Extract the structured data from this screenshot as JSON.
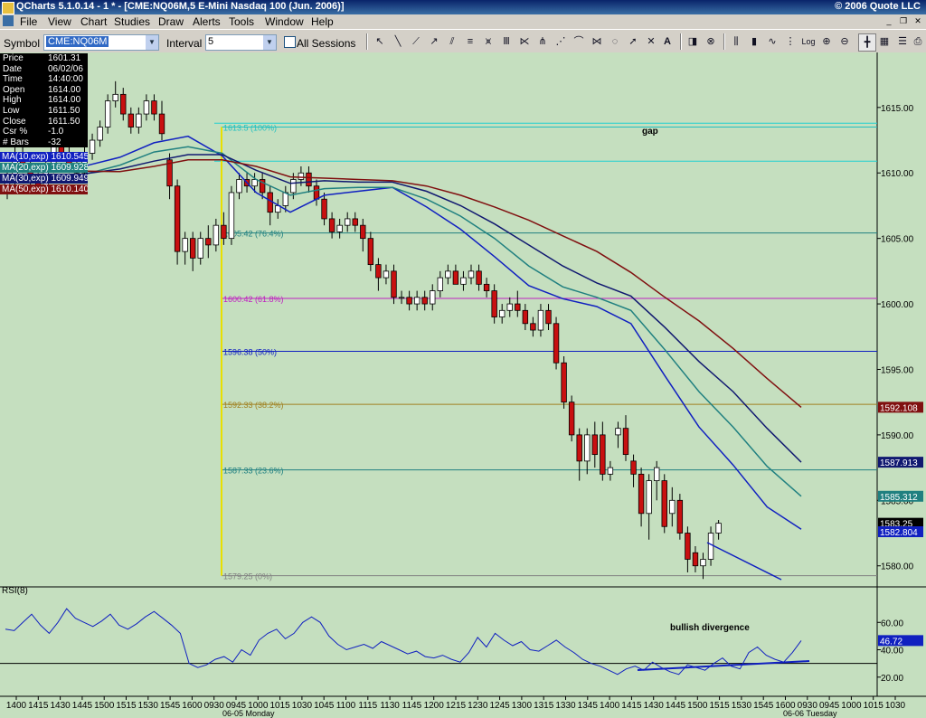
{
  "window": {
    "title": "QCharts 5.1.0.14 - 1 * - [CME:NQ06M,5 E-Mini Nasdaq 100 (Jun. 2006)]",
    "copyright": "© 2006 Quote LLC"
  },
  "menu": [
    "File",
    "View",
    "Chart",
    "Studies",
    "Draw",
    "Alerts",
    "Tools",
    "Window",
    "Help"
  ],
  "toolbar": {
    "symbol_label": "Symbol",
    "symbol_value": "CME:NQ06M",
    "interval_label": "Interval",
    "interval_value": "5",
    "all_sessions_label": "All Sessions",
    "all_sessions_checked": false
  },
  "info": [
    {
      "k": "Price",
      "v": "1601.31"
    },
    {
      "k": "Date",
      "v": "06/02/06"
    },
    {
      "k": "Time",
      "v": "14:40:00"
    },
    {
      "k": "Open",
      "v": "1614.00"
    },
    {
      "k": "High",
      "v": "1614.00"
    },
    {
      "k": "Low",
      "v": "1611.50"
    },
    {
      "k": "Close",
      "v": "1611.50"
    },
    {
      "k": "Csr %",
      "v": "-1.0"
    },
    {
      "k": "# Bars",
      "v": "-32"
    }
  ],
  "moving_averages": [
    {
      "label": "MA(10,exp) 1610.545",
      "color": "#1020c0"
    },
    {
      "label": "MA(20,exp) 1609.928",
      "color": "#208080"
    },
    {
      "label": "MA(30,exp) 1609.949",
      "color": "#101870"
    },
    {
      "label": "MA(50,exp) 1610.140",
      "color": "#801010"
    }
  ],
  "annotations": {
    "gap": "gap",
    "divergence": "bullish divergence",
    "rsi_label": "RSI(8)"
  },
  "fib_levels": [
    {
      "label": "1613.5 (100%)",
      "price": 1613.5,
      "color": "#20c0c0"
    },
    {
      "label": "1605.42 (76.4%)",
      "price": 1605.42,
      "color": "#208080"
    },
    {
      "label": "1600.42 (61.8%)",
      "price": 1600.42,
      "color": "#c020c0"
    },
    {
      "label": "1596.38 (50%)",
      "price": 1596.38,
      "color": "#1020c0"
    },
    {
      "label": "1592.33 (38.2%)",
      "price": 1592.33,
      "color": "#a08020"
    },
    {
      "label": "1587.33 (23.6%)",
      "price": 1587.33,
      "color": "#208080"
    },
    {
      "label": "1579.25 (0%)",
      "price": 1579.25,
      "color": "#808080"
    }
  ],
  "gap_lines": [
    1613.8,
    1610.9
  ],
  "price_axis": {
    "ticks": [
      1615,
      1610,
      1605,
      1600,
      1595,
      1590,
      1585,
      1580
    ],
    "labels": [
      "1615.00",
      "1610.00",
      "1605.00",
      "1600.00",
      "1595.00",
      "1590.00",
      "1585.00",
      "1580.00"
    ]
  },
  "price_tags": [
    {
      "text": "1592.108",
      "price": 1592.108,
      "bg": "#801010",
      "fg": "#fff"
    },
    {
      "text": "1587.913",
      "price": 1587.913,
      "bg": "#101870",
      "fg": "#fff"
    },
    {
      "text": "1585.312",
      "price": 1585.312,
      "bg": "#208080",
      "fg": "#fff"
    },
    {
      "text": "1583.25",
      "price": 1583.25,
      "bg": "#000",
      "fg": "#fff"
    },
    {
      "text": "1582.804",
      "price": 1582.604,
      "bg": "#1020c0",
      "fg": "#fff"
    }
  ],
  "rsi_axis": {
    "ticks": [
      60,
      40,
      20
    ],
    "labels": [
      "60.00",
      "40.00",
      "20.00"
    ],
    "tag": "46.72",
    "tag_value": 46.72
  },
  "time_axis": {
    "labels": [
      "1400",
      "1415",
      "1430",
      "1445",
      "1500",
      "1515",
      "1530",
      "1545",
      "1600",
      "0930",
      "0945",
      "1000",
      "1015",
      "1030",
      "1045",
      "1100",
      "1115",
      "1130",
      "1145",
      "1200",
      "1215",
      "1230",
      "1245",
      "1300",
      "1315",
      "1330",
      "1345",
      "1400",
      "1415",
      "1430",
      "1445",
      "1500",
      "1515",
      "1530",
      "1545",
      "1600",
      "0930",
      "0945",
      "1000",
      "1015",
      "1030"
    ],
    "day1": "06-05 Monday",
    "day2": "06-06 Tuesday"
  },
  "candles": [
    [
      1608.5,
      1610.5,
      1608,
      1609.5
    ],
    [
      1609.5,
      1612,
      1609,
      1611.5
    ],
    [
      1611.5,
      1612,
      1610,
      1610.5
    ],
    [
      1610.5,
      1611,
      1609,
      1609.5
    ],
    [
      1609.5,
      1610,
      1608.5,
      1609
    ],
    [
      1609,
      1611,
      1608.5,
      1610.5
    ],
    [
      1610.5,
      1612.5,
      1610,
      1612
    ],
    [
      1612,
      1613,
      1611,
      1611.5
    ],
    [
      1611.5,
      1612,
      1610,
      1610.5
    ],
    [
      1610.5,
      1611,
      1609.5,
      1610
    ],
    [
      1610,
      1612,
      1609.5,
      1611.5
    ],
    [
      1611.5,
      1613,
      1611,
      1612.5
    ],
    [
      1612.5,
      1614,
      1612,
      1613.5
    ],
    [
      1613.5,
      1616,
      1613,
      1615.5
    ],
    [
      1615.5,
      1617,
      1615,
      1616
    ],
    [
      1616,
      1616.5,
      1614,
      1614.5
    ],
    [
      1614.5,
      1615,
      1613,
      1613.5
    ],
    [
      1613.5,
      1615,
      1613,
      1614.5
    ],
    [
      1614.5,
      1616,
      1614,
      1615.5
    ],
    [
      1615.5,
      1616,
      1614,
      1614.5
    ],
    [
      1614.5,
      1615.5,
      1612.5,
      1613
    ],
    [
      1611,
      1611.5,
      1608,
      1609
    ],
    [
      1609,
      1609.5,
      1603,
      1604
    ],
    [
      1604,
      1605.5,
      1603,
      1605
    ],
    [
      1605,
      1605.5,
      1602.5,
      1603.5
    ],
    [
      1603.5,
      1605.5,
      1603,
      1605
    ],
    [
      1605,
      1606,
      1603.5,
      1604.5
    ],
    [
      1604.5,
      1606.5,
      1604,
      1606
    ],
    [
      1606,
      1607,
      1604.5,
      1605
    ],
    [
      1605,
      1609,
      1604.5,
      1608.5
    ],
    [
      1608.5,
      1610,
      1608,
      1609.5
    ],
    [
      1609.5,
      1610,
      1608.5,
      1609
    ],
    [
      1609,
      1610,
      1608.5,
      1609.5
    ],
    [
      1609.5,
      1610,
      1608,
      1608.5
    ],
    [
      1608.5,
      1609,
      1606,
      1607
    ],
    [
      1607,
      1608,
      1606.5,
      1607.5
    ],
    [
      1607.5,
      1609,
      1607,
      1608.5
    ],
    [
      1608.5,
      1610,
      1608,
      1609.5
    ],
    [
      1609.5,
      1610.5,
      1609,
      1610
    ],
    [
      1610,
      1610.5,
      1608.5,
      1609
    ],
    [
      1609,
      1609.5,
      1607.5,
      1608
    ],
    [
      1608,
      1608.5,
      1606,
      1606.5
    ],
    [
      1606.5,
      1607,
      1605,
      1605.5
    ],
    [
      1605.5,
      1606.5,
      1605,
      1606
    ],
    [
      1606,
      1607,
      1605.5,
      1606.5
    ],
    [
      1606.5,
      1607,
      1605.5,
      1606
    ],
    [
      1606,
      1606.5,
      1604,
      1605
    ],
    [
      1605,
      1605.5,
      1602.5,
      1603
    ],
    [
      1603,
      1603.5,
      1601,
      1602
    ],
    [
      1602,
      1603,
      1601.5,
      1602.5
    ],
    [
      1602.5,
      1603,
      1600,
      1600.5
    ],
    [
      1600.5,
      1601,
      1600,
      1600.5
    ],
    [
      1600.5,
      1601,
      1599.5,
      1600
    ],
    [
      1600,
      1601,
      1599.5,
      1600.5
    ],
    [
      1600.5,
      1601,
      1599.5,
      1600
    ],
    [
      1600,
      1601.5,
      1599.5,
      1601
    ],
    [
      1601,
      1602.5,
      1600.5,
      1602
    ],
    [
      1602,
      1603,
      1601.5,
      1602.5
    ],
    [
      1602.5,
      1603,
      1601.5,
      1601.5
    ],
    [
      1601.5,
      1602.5,
      1601,
      1602
    ],
    [
      1602,
      1603,
      1601.5,
      1602.5
    ],
    [
      1602.5,
      1603,
      1601,
      1601.5
    ],
    [
      1601.5,
      1602,
      1600.5,
      1601
    ],
    [
      1601,
      1601.5,
      1598.5,
      1599
    ],
    [
      1599,
      1600,
      1598.5,
      1599.5
    ],
    [
      1599.5,
      1600.5,
      1599,
      1600
    ],
    [
      1600,
      1601,
      1599,
      1599.5
    ],
    [
      1599.5,
      1600,
      1598,
      1598.5
    ],
    [
      1598.5,
      1599,
      1597.5,
      1598
    ],
    [
      1598,
      1600,
      1597.5,
      1599.5
    ],
    [
      1599.5,
      1600,
      1598,
      1598.5
    ],
    [
      1598.5,
      1599,
      1595,
      1595.5
    ],
    [
      1595.5,
      1596,
      1592,
      1592.5
    ],
    [
      1592.5,
      1593,
      1589.5,
      1590
    ],
    [
      1590,
      1590.5,
      1586.5,
      1588
    ],
    [
      1588,
      1590.5,
      1587,
      1590
    ],
    [
      1590,
      1591,
      1587.5,
      1588.5
    ],
    [
      1590,
      1591,
      1586.5,
      1587
    ],
    [
      1587,
      1588,
      1586.5,
      1587.5
    ],
    [
      1590,
      1591,
      1589,
      1590.5
    ],
    [
      1590.5,
      1591.5,
      1588,
      1588.5
    ],
    [
      1588,
      1588.5,
      1586,
      1587
    ],
    [
      1587,
      1587.5,
      1583,
      1584
    ],
    [
      1584,
      1587,
      1582,
      1586.5
    ],
    [
      1586.5,
      1588,
      1585,
      1587.5
    ],
    [
      1586.5,
      1587,
      1582.5,
      1583
    ],
    [
      1584,
      1586,
      1583,
      1585
    ],
    [
      1585,
      1585.5,
      1582,
      1582.5
    ],
    [
      1582.5,
      1583,
      1579.5,
      1580.5
    ],
    [
      1581,
      1581.5,
      1579.5,
      1580
    ],
    [
      1580,
      1581,
      1579,
      1580.5
    ],
    [
      1580.5,
      1583,
      1580,
      1582.5
    ],
    [
      1582.5,
      1583.5,
      1582,
      1583.25
    ]
  ],
  "ma_series": {
    "ma10": [
      1610.545,
      1611.2,
      1612.3,
      1612.8,
      1611.3,
      1608.5,
      1607,
      1608.3,
      1608.6,
      1608.9,
      1607.4,
      1605.7,
      1603.6,
      1601.4,
      1600.4,
      1599.8,
      1598.5,
      1594.5,
      1590.6,
      1587.7,
      1584.5,
      1582.8
    ],
    "ma20": [
      1609.928,
      1610.6,
      1611.6,
      1612,
      1611.5,
      1609.5,
      1608.3,
      1608.8,
      1608.9,
      1608.9,
      1608,
      1606.7,
      1605,
      1602.9,
      1601.3,
      1600.5,
      1599.5,
      1596.5,
      1593.3,
      1590.6,
      1587.6,
      1585.312
    ],
    "ma30": [
      1609.949,
      1610.3,
      1610.9,
      1611.4,
      1611.4,
      1610.2,
      1609.2,
      1609.4,
      1609.3,
      1609.3,
      1608.6,
      1607.5,
      1606.1,
      1604.5,
      1602.9,
      1601.6,
      1600.6,
      1598.2,
      1595.6,
      1593.3,
      1590.5,
      1587.913
    ],
    "ma50": [
      1610.14,
      1610.1,
      1610.5,
      1611,
      1611,
      1610.5,
      1609.7,
      1609.6,
      1609.5,
      1609.4,
      1609,
      1608.3,
      1607.4,
      1606.4,
      1605.2,
      1604,
      1602.4,
      1600.5,
      1598.7,
      1596.6,
      1594.3,
      1592.108
    ]
  },
  "rsi": [
    55,
    54,
    60,
    66,
    58,
    52,
    60,
    70,
    63,
    60,
    57,
    61,
    66,
    58,
    55,
    59,
    64,
    68,
    63,
    58,
    52,
    30,
    27,
    29,
    33,
    35,
    31,
    40,
    36,
    47,
    52,
    55,
    48,
    52,
    60,
    64,
    60,
    50,
    44,
    40,
    42,
    44,
    41,
    46,
    43,
    40,
    37,
    39,
    35,
    34,
    36,
    33,
    31,
    38,
    49,
    42,
    52,
    47,
    43,
    46,
    40,
    39,
    43,
    47,
    42,
    38,
    33,
    30,
    28,
    25,
    22,
    26,
    28,
    25,
    31,
    27,
    24,
    22,
    29,
    27,
    25,
    30,
    34,
    28,
    26,
    38,
    42,
    36,
    33,
    31,
    38,
    46.72
  ]
}
